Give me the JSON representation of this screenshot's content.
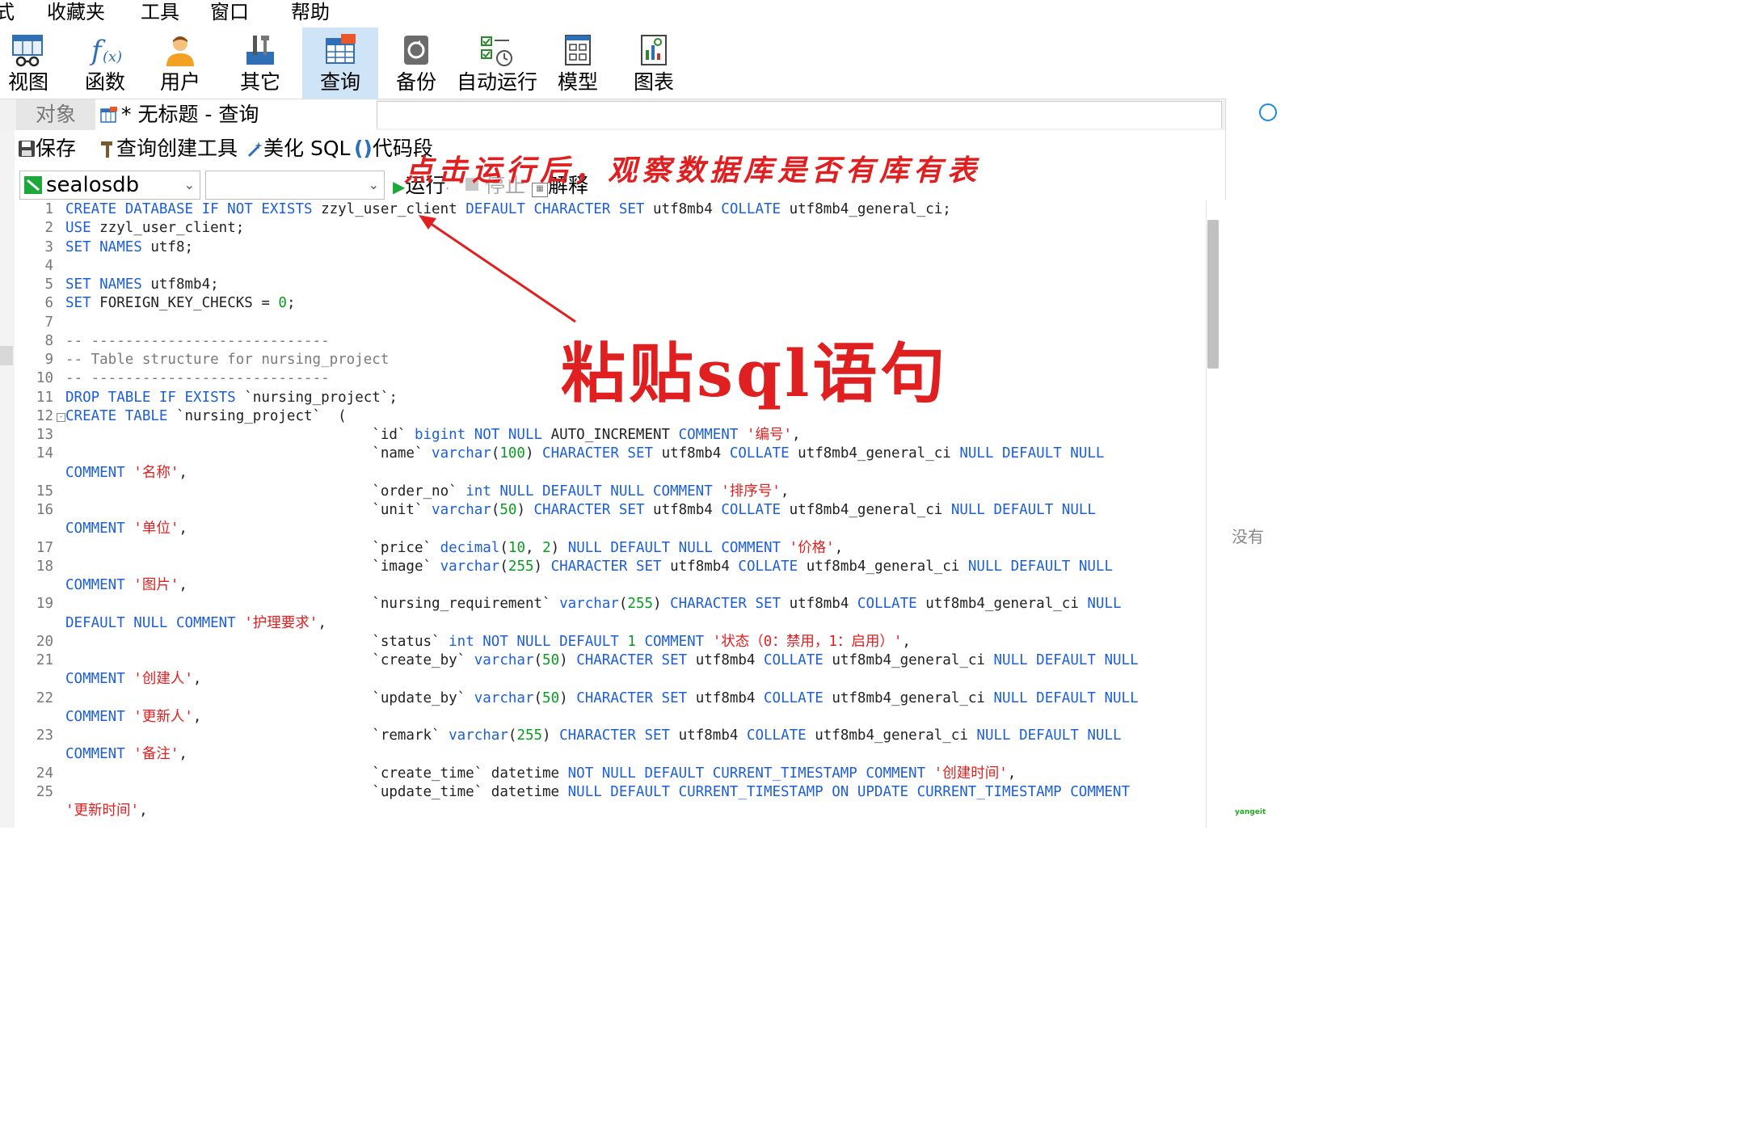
{
  "menubar": {
    "items": [
      "式",
      "收藏夹",
      "工具",
      "窗口",
      "帮助"
    ]
  },
  "toolbar": {
    "items": [
      {
        "label": "视图",
        "icon": "view-icon"
      },
      {
        "label": "函数",
        "icon": "function-icon"
      },
      {
        "label": "用户",
        "icon": "user-icon"
      },
      {
        "label": "其它",
        "icon": "tools-icon"
      },
      {
        "label": "查询",
        "icon": "query-icon",
        "active": true
      },
      {
        "label": "备份",
        "icon": "backup-icon"
      },
      {
        "label": "自动运行",
        "icon": "auto-run-icon"
      },
      {
        "label": "模型",
        "icon": "model-icon"
      },
      {
        "label": "图表",
        "icon": "chart-icon"
      }
    ]
  },
  "tabs": {
    "objects_label": "对象",
    "query_label": "* 无标题 - 查询"
  },
  "query_toolbar": {
    "save": "保存",
    "builder": "查询创建工具",
    "beautify": "美化 SQL",
    "snippet": "代码段"
  },
  "connection": {
    "database": "sealosdb",
    "schema": "",
    "run": "运行",
    "stop": "停止",
    "explain": "解释"
  },
  "annotations": {
    "top": "点击运行后，观察数据库是否有库有表",
    "paste": "粘贴sql语句"
  },
  "right_panel": {
    "note": "没有"
  },
  "watermark": "yangeit",
  "colors": {
    "keyword": "#1c5fd8",
    "string": "#e02020",
    "number": "#0a9c20",
    "comment": "#7a7a7a",
    "annotation": "#e02020",
    "active_tool": "#cfe4f7"
  },
  "editor": {
    "lines": [
      {
        "n": "1",
        "parts": [
          [
            "kw",
            "CREATE DATABASE IF NOT EXISTS "
          ],
          [
            "plain",
            "zzyl_user_client "
          ],
          [
            "kw",
            "DEFAULT CHARACTER SET "
          ],
          [
            "plain",
            "utf8mb4 "
          ],
          [
            "kw",
            "COLLATE "
          ],
          [
            "plain",
            "utf8mb4_general_ci;"
          ]
        ]
      },
      {
        "n": "2",
        "parts": [
          [
            "kw",
            "USE "
          ],
          [
            "plain",
            "zzyl_user_client;"
          ]
        ]
      },
      {
        "n": "3",
        "parts": [
          [
            "kw",
            "SET NAMES "
          ],
          [
            "plain",
            "utf8;"
          ]
        ]
      },
      {
        "n": "4",
        "parts": []
      },
      {
        "n": "5",
        "parts": [
          [
            "kw",
            "SET NAMES "
          ],
          [
            "plain",
            "utf8mb4;"
          ]
        ]
      },
      {
        "n": "6",
        "parts": [
          [
            "kw",
            "SET "
          ],
          [
            "plain",
            "FOREIGN_KEY_CHECKS = "
          ],
          [
            "num",
            "0"
          ],
          [
            "plain",
            ";"
          ]
        ]
      },
      {
        "n": "7",
        "parts": []
      },
      {
        "n": "8",
        "parts": [
          [
            "cmt",
            "-- ----------------------------"
          ]
        ]
      },
      {
        "n": "9",
        "parts": [
          [
            "cmt",
            "-- Table structure for nursing_project"
          ]
        ]
      },
      {
        "n": "10",
        "parts": [
          [
            "cmt",
            "-- ----------------------------"
          ]
        ]
      },
      {
        "n": "11",
        "parts": [
          [
            "kw",
            "DROP TABLE IF EXISTS "
          ],
          [
            "plain",
            "`nursing_project`;"
          ]
        ]
      },
      {
        "n": "12",
        "fold": true,
        "parts": [
          [
            "kw",
            "CREATE TABLE "
          ],
          [
            "plain",
            "`nursing_project`  ("
          ]
        ]
      },
      {
        "n": "13",
        "parts": [
          [
            "plain",
            "                                    `id` "
          ],
          [
            "kw",
            "bigint NOT NULL "
          ],
          [
            "plain",
            "AUTO_INCREMENT "
          ],
          [
            "kw",
            "COMMENT "
          ],
          [
            "str",
            "'编号'"
          ],
          [
            "plain",
            ","
          ]
        ]
      },
      {
        "n": "14",
        "parts": [
          [
            "plain",
            "                                    `name` "
          ],
          [
            "kw",
            "varchar"
          ],
          [
            "plain",
            "("
          ],
          [
            "num",
            "100"
          ],
          [
            "plain",
            ") "
          ],
          [
            "kw",
            "CHARACTER SET "
          ],
          [
            "plain",
            "utf8mb4 "
          ],
          [
            "kw",
            "COLLATE "
          ],
          [
            "plain",
            "utf8mb4_general_ci "
          ],
          [
            "kw",
            "NULL DEFAULT NULL"
          ]
        ]
      },
      {
        "n": "",
        "parts": [
          [
            "kw",
            "COMMENT "
          ],
          [
            "str",
            "'名称'"
          ],
          [
            "plain",
            ","
          ]
        ]
      },
      {
        "n": "15",
        "parts": [
          [
            "plain",
            "                                    `order_no` "
          ],
          [
            "kw",
            "int NULL DEFAULT NULL COMMENT "
          ],
          [
            "str",
            "'排序号'"
          ],
          [
            "plain",
            ","
          ]
        ]
      },
      {
        "n": "16",
        "parts": [
          [
            "plain",
            "                                    `unit` "
          ],
          [
            "kw",
            "varchar"
          ],
          [
            "plain",
            "("
          ],
          [
            "num",
            "50"
          ],
          [
            "plain",
            ") "
          ],
          [
            "kw",
            "CHARACTER SET "
          ],
          [
            "plain",
            "utf8mb4 "
          ],
          [
            "kw",
            "COLLATE "
          ],
          [
            "plain",
            "utf8mb4_general_ci "
          ],
          [
            "kw",
            "NULL DEFAULT NULL"
          ]
        ]
      },
      {
        "n": "",
        "parts": [
          [
            "kw",
            "COMMENT "
          ],
          [
            "str",
            "'单位'"
          ],
          [
            "plain",
            ","
          ]
        ]
      },
      {
        "n": "17",
        "parts": [
          [
            "plain",
            "                                    `price` "
          ],
          [
            "kw",
            "decimal"
          ],
          [
            "plain",
            "("
          ],
          [
            "num",
            "10"
          ],
          [
            "plain",
            ", "
          ],
          [
            "num",
            "2"
          ],
          [
            "plain",
            ") "
          ],
          [
            "kw",
            "NULL DEFAULT NULL COMMENT "
          ],
          [
            "str",
            "'价格'"
          ],
          [
            "plain",
            ","
          ]
        ]
      },
      {
        "n": "18",
        "parts": [
          [
            "plain",
            "                                    `image` "
          ],
          [
            "kw",
            "varchar"
          ],
          [
            "plain",
            "("
          ],
          [
            "num",
            "255"
          ],
          [
            "plain",
            ") "
          ],
          [
            "kw",
            "CHARACTER SET "
          ],
          [
            "plain",
            "utf8mb4 "
          ],
          [
            "kw",
            "COLLATE "
          ],
          [
            "plain",
            "utf8mb4_general_ci "
          ],
          [
            "kw",
            "NULL DEFAULT NULL"
          ]
        ]
      },
      {
        "n": "",
        "parts": [
          [
            "kw",
            "COMMENT "
          ],
          [
            "str",
            "'图片'"
          ],
          [
            "plain",
            ","
          ]
        ]
      },
      {
        "n": "19",
        "parts": [
          [
            "plain",
            "                                    `nursing_requirement` "
          ],
          [
            "kw",
            "varchar"
          ],
          [
            "plain",
            "("
          ],
          [
            "num",
            "255"
          ],
          [
            "plain",
            ") "
          ],
          [
            "kw",
            "CHARACTER SET "
          ],
          [
            "plain",
            "utf8mb4 "
          ],
          [
            "kw",
            "COLLATE "
          ],
          [
            "plain",
            "utf8mb4_general_ci "
          ],
          [
            "kw",
            "NULL"
          ]
        ]
      },
      {
        "n": "",
        "parts": [
          [
            "kw",
            "DEFAULT NULL COMMENT "
          ],
          [
            "str",
            "'护理要求'"
          ],
          [
            "plain",
            ","
          ]
        ]
      },
      {
        "n": "20",
        "parts": [
          [
            "plain",
            "                                    `status` "
          ],
          [
            "kw",
            "int NOT NULL DEFAULT "
          ],
          [
            "num",
            "1 "
          ],
          [
            "kw",
            "COMMENT "
          ],
          [
            "str",
            "'状态（0：禁用，1：启用）'"
          ],
          [
            "plain",
            ","
          ]
        ]
      },
      {
        "n": "21",
        "parts": [
          [
            "plain",
            "                                    `create_by` "
          ],
          [
            "kw",
            "varchar"
          ],
          [
            "plain",
            "("
          ],
          [
            "num",
            "50"
          ],
          [
            "plain",
            ") "
          ],
          [
            "kw",
            "CHARACTER SET "
          ],
          [
            "plain",
            "utf8mb4 "
          ],
          [
            "kw",
            "COLLATE "
          ],
          [
            "plain",
            "utf8mb4_general_ci "
          ],
          [
            "kw",
            "NULL DEFAULT NULL"
          ]
        ]
      },
      {
        "n": "",
        "parts": [
          [
            "kw",
            "COMMENT "
          ],
          [
            "str",
            "'创建人'"
          ],
          [
            "plain",
            ","
          ]
        ]
      },
      {
        "n": "22",
        "parts": [
          [
            "plain",
            "                                    `update_by` "
          ],
          [
            "kw",
            "varchar"
          ],
          [
            "plain",
            "("
          ],
          [
            "num",
            "50"
          ],
          [
            "plain",
            ") "
          ],
          [
            "kw",
            "CHARACTER SET "
          ],
          [
            "plain",
            "utf8mb4 "
          ],
          [
            "kw",
            "COLLATE "
          ],
          [
            "plain",
            "utf8mb4_general_ci "
          ],
          [
            "kw",
            "NULL DEFAULT NULL"
          ]
        ]
      },
      {
        "n": "",
        "parts": [
          [
            "kw",
            "COMMENT "
          ],
          [
            "str",
            "'更新人'"
          ],
          [
            "plain",
            ","
          ]
        ]
      },
      {
        "n": "23",
        "parts": [
          [
            "plain",
            "                                    `remark` "
          ],
          [
            "kw",
            "varchar"
          ],
          [
            "plain",
            "("
          ],
          [
            "num",
            "255"
          ],
          [
            "plain",
            ") "
          ],
          [
            "kw",
            "CHARACTER SET "
          ],
          [
            "plain",
            "utf8mb4 "
          ],
          [
            "kw",
            "COLLATE "
          ],
          [
            "plain",
            "utf8mb4_general_ci "
          ],
          [
            "kw",
            "NULL DEFAULT NULL"
          ]
        ]
      },
      {
        "n": "",
        "parts": [
          [
            "kw",
            "COMMENT "
          ],
          [
            "str",
            "'备注'"
          ],
          [
            "plain",
            ","
          ]
        ]
      },
      {
        "n": "24",
        "parts": [
          [
            "plain",
            "                                    `create_time` datetime "
          ],
          [
            "kw",
            "NOT NULL DEFAULT CURRENT_TIMESTAMP COMMENT "
          ],
          [
            "str",
            "'创建时间'"
          ],
          [
            "plain",
            ","
          ]
        ]
      },
      {
        "n": "25",
        "parts": [
          [
            "plain",
            "                                    `update_time` datetime "
          ],
          [
            "kw",
            "NULL DEFAULT CURRENT_TIMESTAMP ON UPDATE CURRENT_TIMESTAMP COMMENT"
          ]
        ]
      },
      {
        "n": "",
        "parts": [
          [
            "str",
            "'更新时间'"
          ],
          [
            "plain",
            ","
          ]
        ]
      }
    ]
  }
}
